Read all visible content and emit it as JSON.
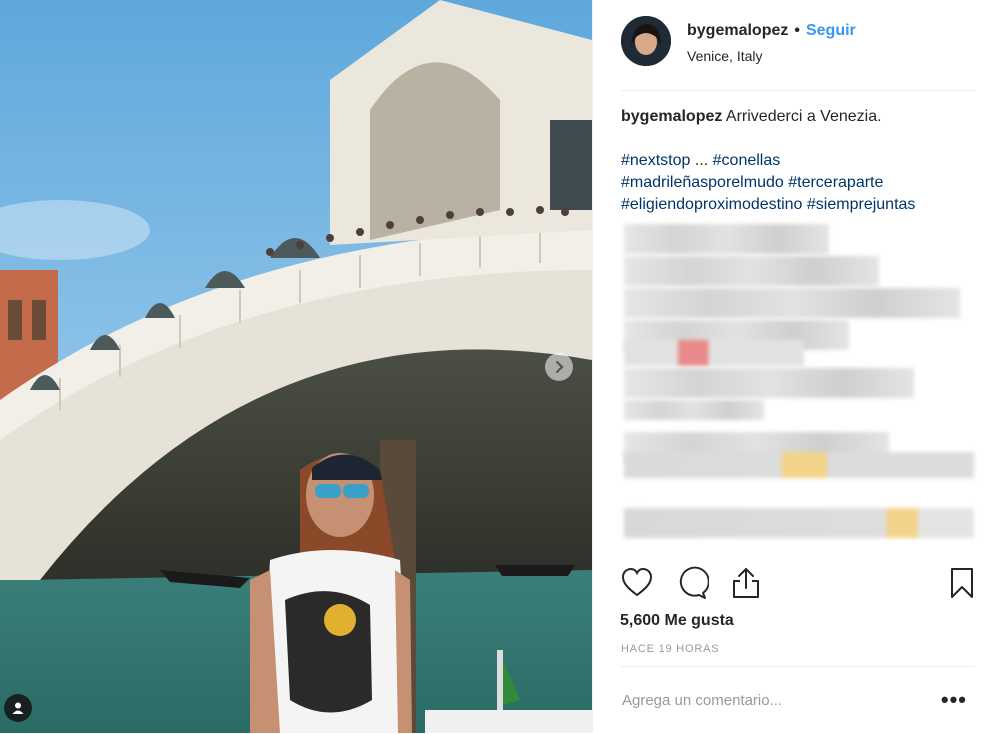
{
  "post": {
    "username": "bygemalopez",
    "follow_label": "Seguir",
    "separator": "•",
    "location": "Venice, Italy"
  },
  "caption": {
    "username": "bygemalopez",
    "text": "Arrivederci a Venezia.",
    "line1_tags": [
      "#nextstop",
      "...",
      "#conellas"
    ],
    "line2_tags": [
      "#madrileñasporelmudo",
      "#terceraparte"
    ],
    "line3_tags": [
      "#eligiendoproximodestino",
      "#siemprejuntas"
    ]
  },
  "engagement": {
    "likes": "5,600 Me gusta",
    "timestamp": "HACE 19 HORAS"
  },
  "comment": {
    "placeholder": "Agrega un comentario...",
    "more_label": "•••"
  },
  "colors": {
    "link": "#3897f0",
    "hashtag": "#003569",
    "text": "#262626",
    "muted": "#999999",
    "border": "#efefef"
  },
  "icons": {
    "like": "heart-icon",
    "comment": "comment-icon",
    "share": "share-icon",
    "save": "bookmark-icon",
    "next": "chevron-right-icon",
    "tag": "user-tag-icon"
  }
}
